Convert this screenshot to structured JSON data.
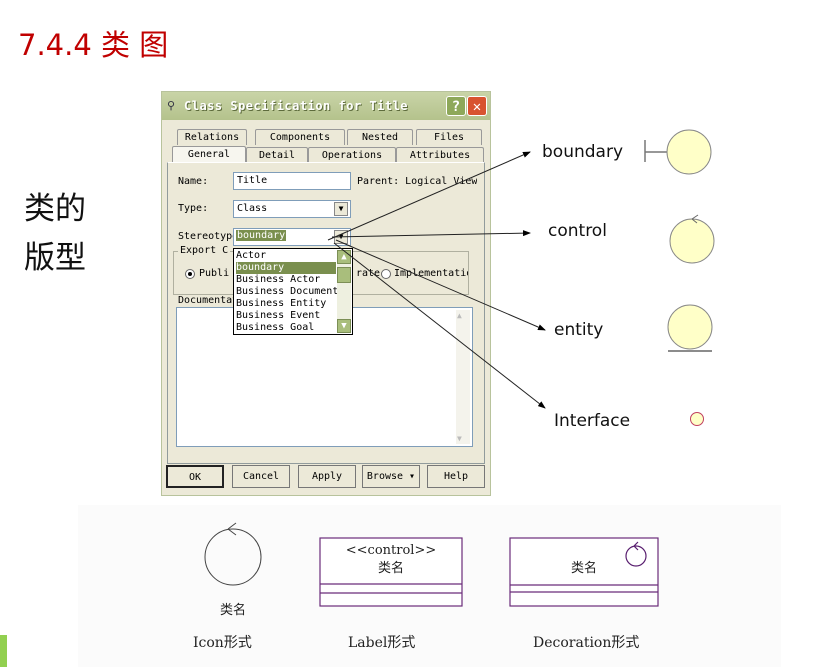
{
  "slide": {
    "title": "7.4.4 类 图",
    "side_label_line1": "类的",
    "side_label_line2": "版型",
    "accent_color": "#92d050",
    "title_color": "#c00000"
  },
  "dialog": {
    "title": "Class Specification for Title",
    "help_glyph": "?",
    "close_glyph": "✕",
    "tabs_row1": [
      "Relations",
      "Components",
      "Nested",
      "Files"
    ],
    "tabs_row2": [
      "General",
      "Detail",
      "Operations",
      "Attributes"
    ],
    "active_tab": "General",
    "name_label": "Name:",
    "name_value": "Title",
    "parent_label": "Parent: Logical View",
    "type_label": "Type:",
    "type_value": "Class",
    "stereotype_label": "Stereotype:",
    "stereotype_value": "boundary",
    "export_label": "Export C",
    "radio_public": "Publi",
    "radio_private": "rate",
    "radio_implementation": "Implementatio",
    "documentation_label": "Documentat",
    "dropdown_items": [
      "Actor",
      "boundary",
      "Business Actor",
      "Business Document",
      "Business Entity",
      "Business Event",
      "Business Goal"
    ],
    "dropdown_selected": "boundary",
    "buttons": {
      "ok": "OK",
      "cancel": "Cancel",
      "apply": "Apply",
      "browse": "Browse ▾",
      "help": "Help"
    }
  },
  "stereotypes": [
    {
      "label": "boundary",
      "icon": "boundary-icon"
    },
    {
      "label": "control",
      "icon": "control-icon"
    },
    {
      "label": "entity",
      "icon": "entity-icon"
    },
    {
      "label": "Interface",
      "icon": "interface-icon"
    }
  ],
  "forms": {
    "icon_class_name": "类名",
    "icon_caption": "Icon形式",
    "label_stereotype": "<<control>>",
    "label_class_name": "类名",
    "label_caption": "Label形式",
    "decoration_class_name": "类名",
    "decoration_caption": "Decoration形式"
  },
  "colors": {
    "icon_fill": "#ffffc8",
    "class_box_border": "#6b2c7a"
  }
}
